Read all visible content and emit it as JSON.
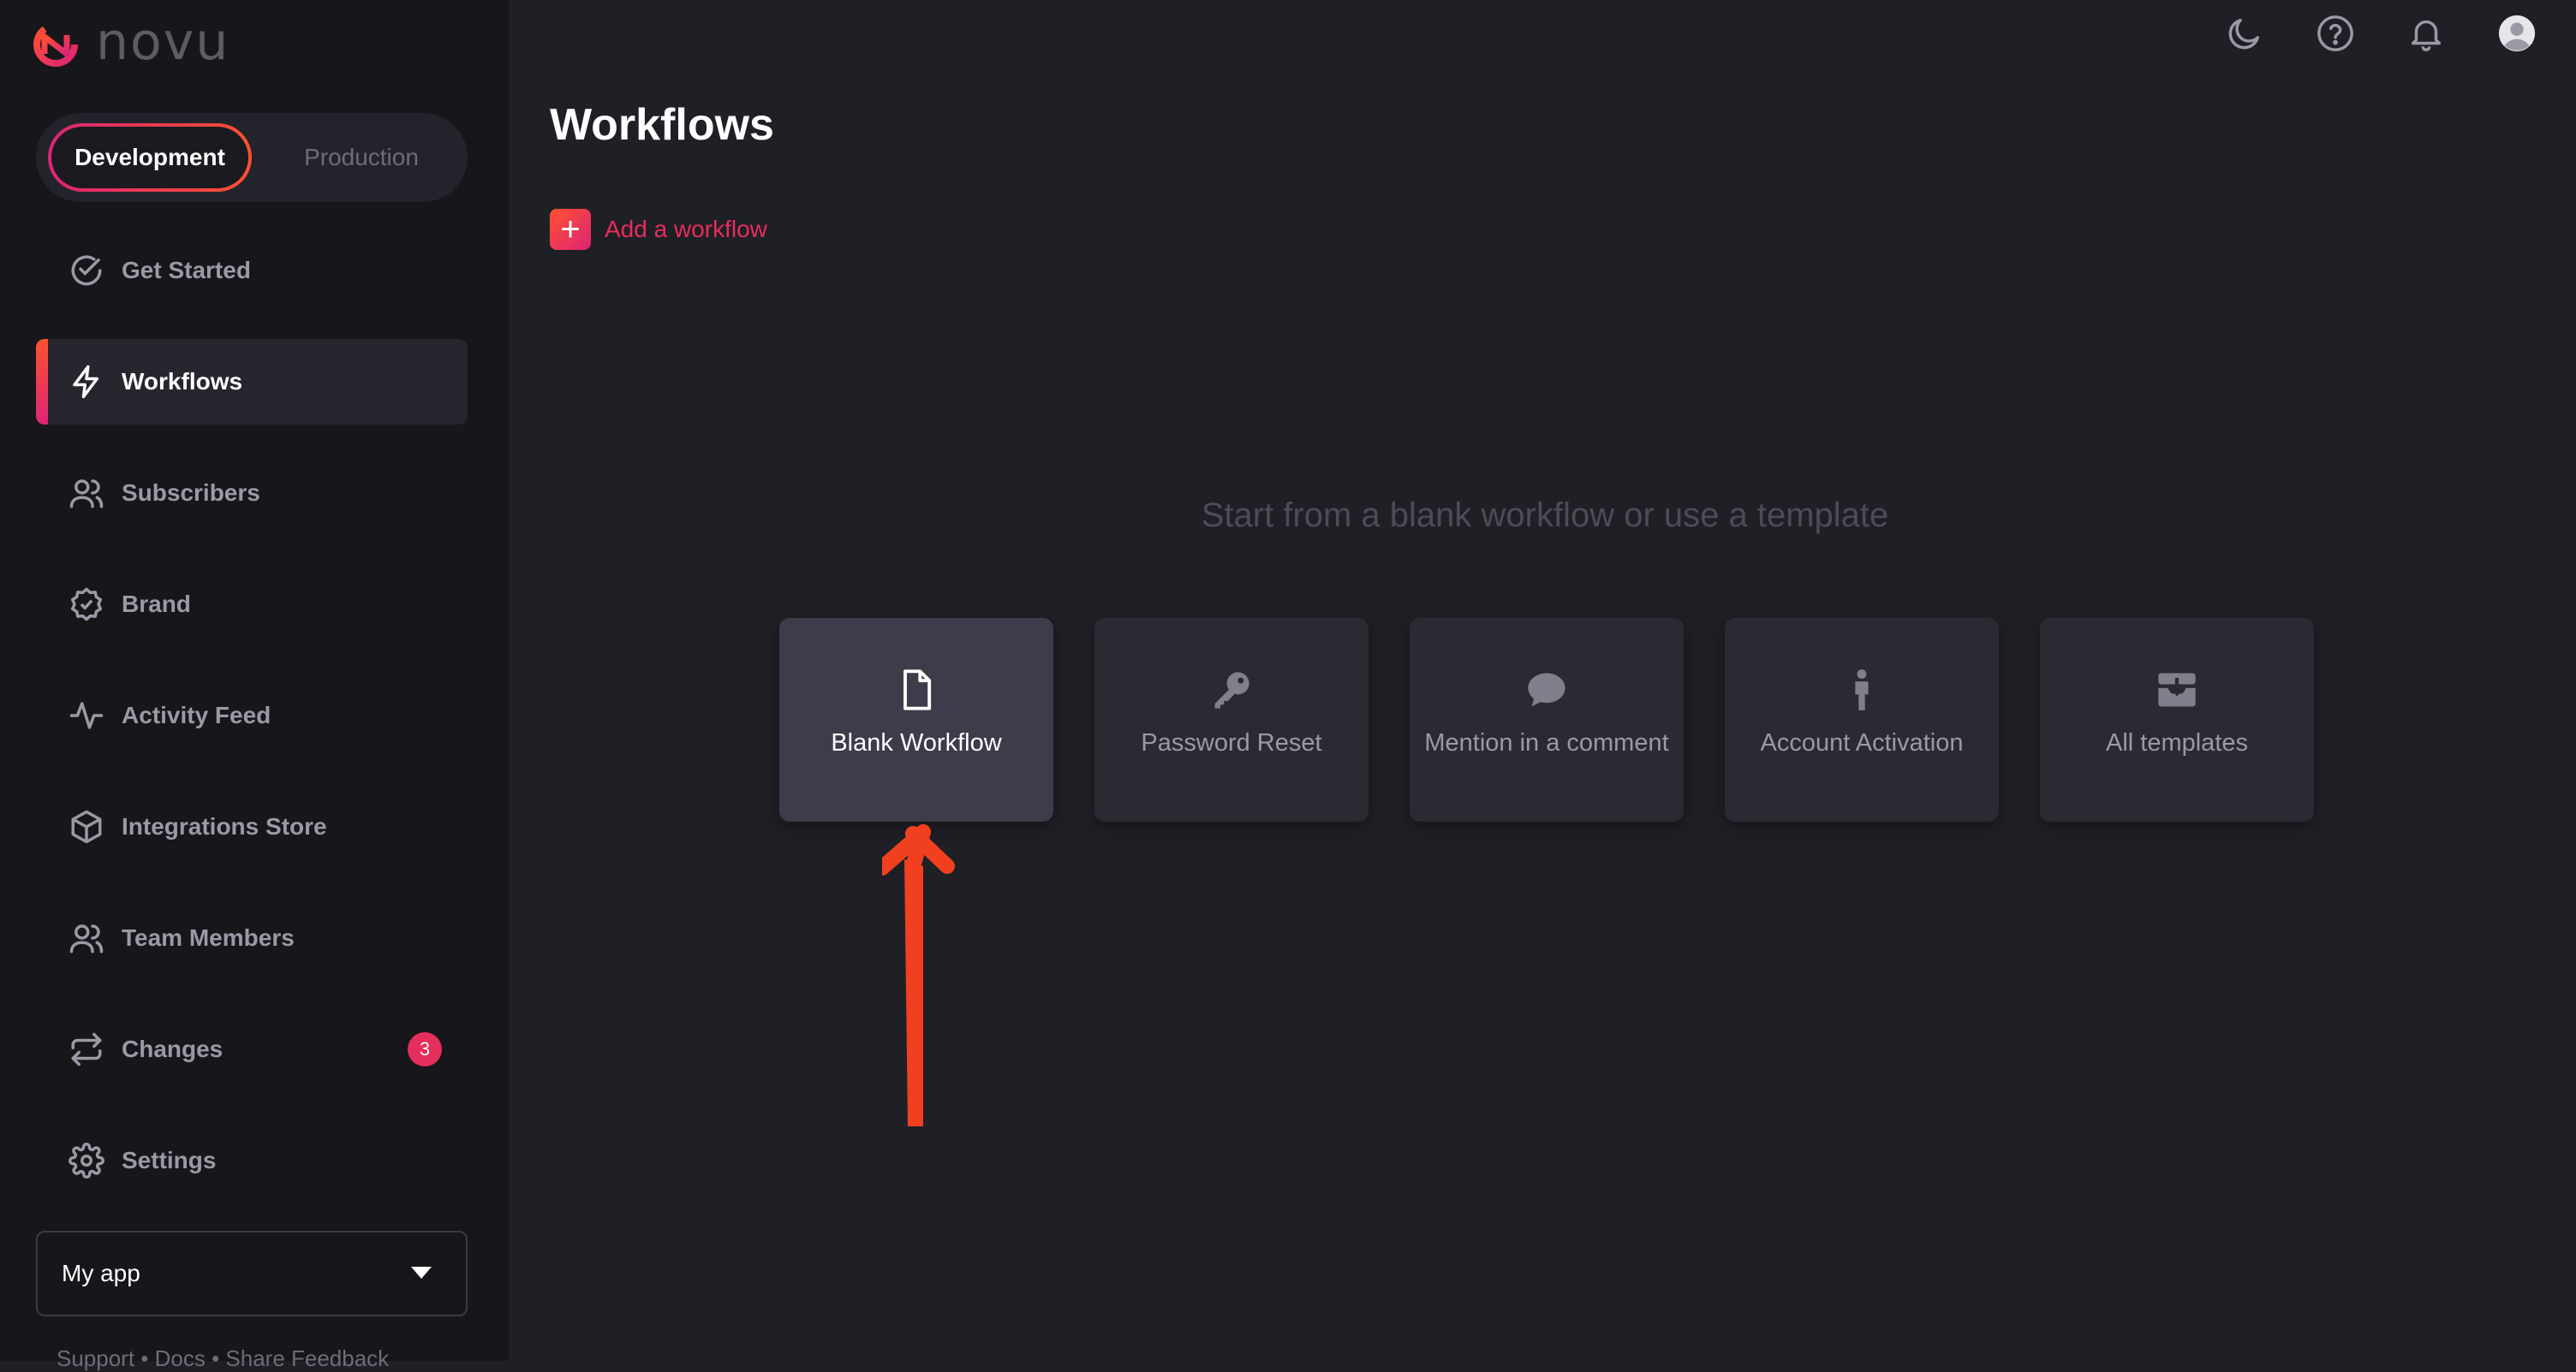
{
  "brand": {
    "name": "novu"
  },
  "environment": {
    "active": "Development",
    "inactive": "Production"
  },
  "sidebar": {
    "items": [
      {
        "label": "Get Started",
        "icon": "check-circle-icon"
      },
      {
        "label": "Workflows",
        "icon": "lightning-icon",
        "active": true
      },
      {
        "label": "Subscribers",
        "icon": "users-icon"
      },
      {
        "label": "Brand",
        "icon": "badge-check-icon"
      },
      {
        "label": "Activity Feed",
        "icon": "activity-icon"
      },
      {
        "label": "Integrations Store",
        "icon": "box-icon"
      },
      {
        "label": "Team Members",
        "icon": "team-icon"
      },
      {
        "label": "Changes",
        "icon": "repeat-icon",
        "badge": "3"
      },
      {
        "label": "Settings",
        "icon": "gear-icon"
      }
    ],
    "app_select": {
      "value": "My app"
    },
    "footer": "Support • Docs • Share Feedback"
  },
  "header": {
    "icons": [
      "moon-icon",
      "help-icon",
      "bell-icon",
      "avatar-icon"
    ]
  },
  "main": {
    "title": "Workflows",
    "add_label": "Add a workflow",
    "hint": "Start from a blank workflow or use a template",
    "templates": [
      {
        "label": "Blank Workflow",
        "icon": "file-icon",
        "selected": true
      },
      {
        "label": "Password Reset",
        "icon": "key-icon"
      },
      {
        "label": "Mention in a comment",
        "icon": "comment-icon"
      },
      {
        "label": "Account Activation",
        "icon": "person-icon"
      },
      {
        "label": "All templates",
        "icon": "inbox-icon"
      }
    ]
  },
  "colors": {
    "accent": "#e52e5b",
    "gradient_start": "#ff512f",
    "gradient_end": "#dd2476",
    "annotation_arrow": "#f0401f"
  }
}
